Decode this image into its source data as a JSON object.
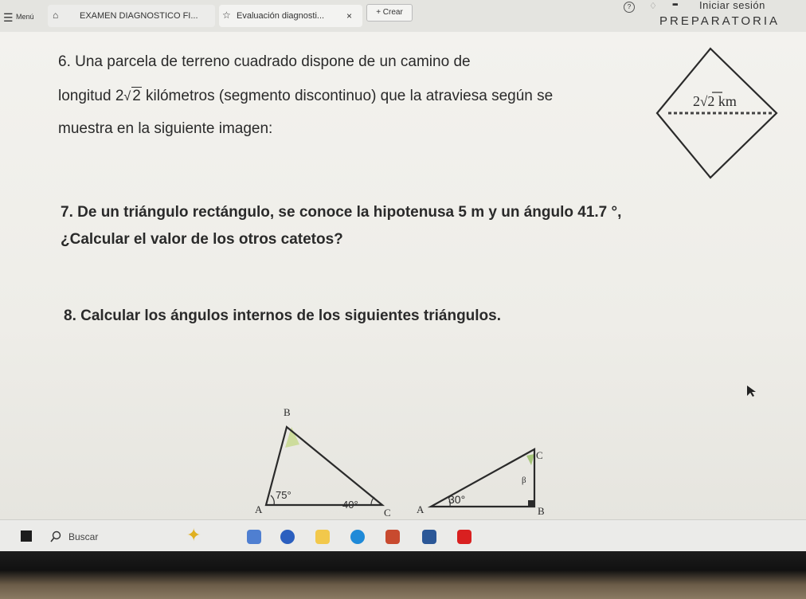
{
  "browser": {
    "menu_label": "Menú",
    "tab1_label": "EXAMEN DIAGNOSTICO FI...",
    "tab2_label": "Evaluación diagnosti...",
    "close_glyph": "×",
    "new_button_label": "+ Crear",
    "signin_label": "Iniciar sesión",
    "header_text": "PREPARATORIA"
  },
  "questions": {
    "q6_line1": "6. Una parcela de terreno cuadrado dispone de un camino de",
    "q6_line2_a": "longitud 2",
    "q6_line2_radicand": "2",
    "q6_line2_b": " kilómetros (segmento discontinuo) que la atraviesa según se",
    "q6_line3": "muestra en la siguiente imagen:",
    "q7_line1": "7. De un triángulo rectángulo, se conoce la hipotenusa  5 m y un ángulo 41.7 °,",
    "q7_line2": "¿Calcular el valor de los otros catetos?",
    "q8_line1": "8. Calcular los ángulos internos de los siguientes triángulos."
  },
  "diamond": {
    "label_coef": "2",
    "label_radicand": "2",
    "label_unit": " km"
  },
  "triangle1": {
    "vertex_b": "B",
    "vertex_a": "A",
    "vertex_c": "C",
    "angle_a": "75°",
    "angle_c": "40°"
  },
  "triangle2": {
    "vertex_c": "C",
    "vertex_a": "A",
    "vertex_b": "B",
    "angle_c": "β",
    "angle_a": "30°"
  },
  "taskbar": {
    "search_label": "Buscar"
  },
  "colors": {
    "text": "#2a2a2a",
    "dashed_line": "#444444",
    "taskbar": "#ebebe9",
    "highlight_green": "#bfd69a"
  }
}
